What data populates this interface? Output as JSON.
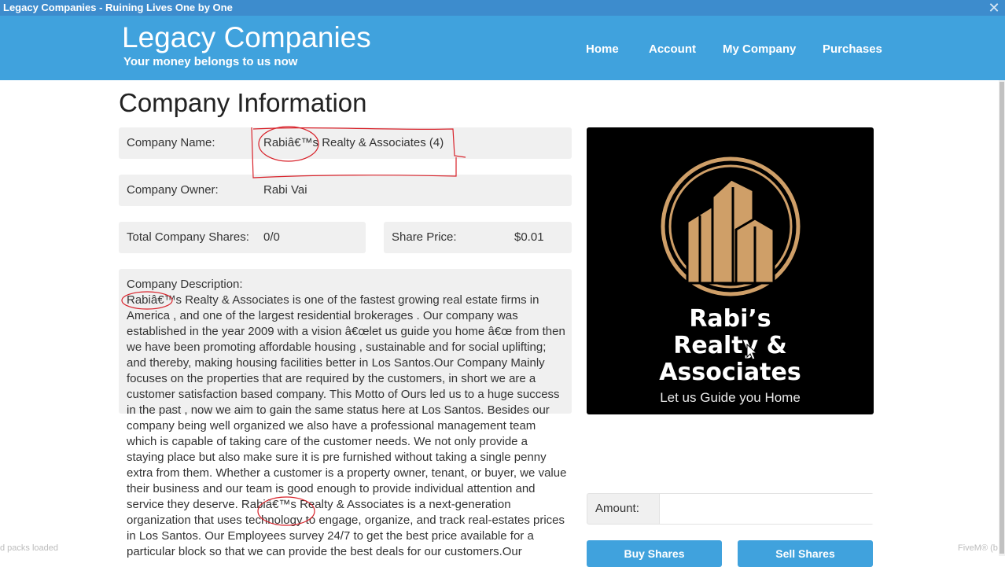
{
  "window": {
    "title": "Legacy Companies - Ruining Lives One by One",
    "close_icon": "close-icon"
  },
  "header": {
    "brand": "Legacy Companies",
    "tagline": "Your money belongs to us now",
    "nav": [
      "Home",
      "Account",
      "My Company",
      "Purchases"
    ]
  },
  "page": {
    "title": "Company Information"
  },
  "company": {
    "name_label": "Company Name:",
    "name_value": "Rabiâ€™s Realty & Associates (4)",
    "owner_label": "Company Owner:",
    "owner_value": "Rabi Vai",
    "shares_label": "Total Company Shares:",
    "shares_value": "0/0",
    "price_label": "Share Price:",
    "price_value": "$0.01",
    "description_label": "Company Description:",
    "description": "Rabiâ€™s Realty & Associates is one of the fastest growing real estate firms in America , and one of the largest residential brokerages . Our company was established in the year 2009 with a vision â€œlet us guide you home â€œ from then we have been promoting affordable housing , sustainable and for social uplifting; and thereby, making housing facilities better in Los Santos.Our Company Mainly focuses on the properties that are required by the customers, in short we are a customer satisfaction based company. This Motto of Ours led us to a huge success in the past , now we aim to gain the same status here at Los Santos. Besides our company being well organized we also have a professional management team which is capable of taking care of the customer needs. We not only provide a staying place but also make sure it is pre furnished without taking a single penny extra from them. Whether a customer is a property owner, tenant, or buyer, we value their business and our team is good enough to provide individual attention and service they deserve. Rabiâ€™s Realty & Associates is a next-generation organization that uses technology to engage, organize, and track real-estates prices in Los Santos. Our Employees survey 24/7 to get the best price available for a particular block so that we can provide the best deals for our customers.Our"
  },
  "logo": {
    "line1": "Rabi’s",
    "line2": "Realty &",
    "line3": "Associates",
    "tagline": "Let us Guide you Home",
    "gold": "#cf9f68"
  },
  "trade": {
    "amount_label": "Amount:",
    "amount_value": "",
    "buy_label": "Buy Shares",
    "sell_label": "Sell Shares"
  },
  "overlay": {
    "left": "d packs loaded",
    "right": "FiveM® (b"
  },
  "colors": {
    "header": "#40a2dd",
    "titlebar": "#3d8ccd",
    "annotation": "#d8222a"
  }
}
